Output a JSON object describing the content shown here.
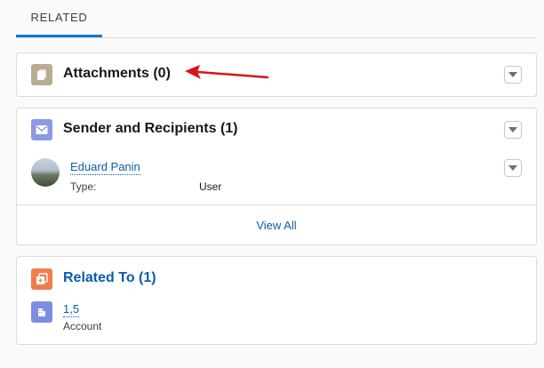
{
  "tabs": [
    {
      "label": "RELATED"
    }
  ],
  "cards": {
    "attachments": {
      "title": "Attachments (0)",
      "icon": "file-icon",
      "color": "#baac93"
    },
    "senders": {
      "title": "Sender and Recipients (1)",
      "icon": "email-icon",
      "color": "#8b9ae3",
      "items": [
        {
          "name": "Eduard Panin",
          "type_label": "Type:",
          "type_value": "User",
          "avatar": "user-avatar"
        }
      ],
      "footer_link": "View All"
    },
    "related": {
      "title": "Related To (1)",
      "icon": "related-icon",
      "color": "#ef7e4f",
      "items": [
        {
          "name": "1,5",
          "type": "Account",
          "icon": "account-icon",
          "color": "#7f8de1"
        }
      ]
    }
  },
  "annotation": {
    "type": "arrow",
    "color": "#d9151b"
  },
  "colors": {
    "link": "#0b5cab",
    "tab_active": "#0176d3",
    "border": "#dddbda"
  }
}
